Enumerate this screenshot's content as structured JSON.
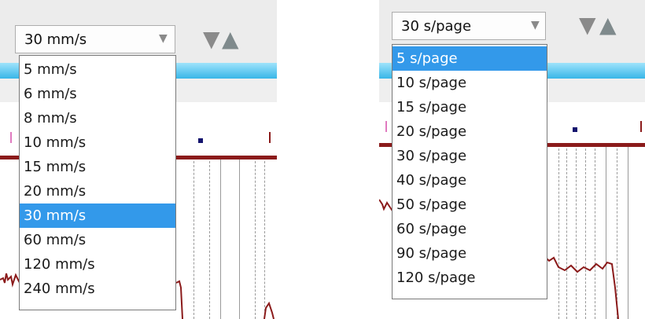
{
  "left_panel": {
    "speed_select": {
      "value": "30 mm/s"
    },
    "nav": {
      "down_icon": "triangle-down-icon",
      "up_icon": "triangle-up-icon"
    },
    "options": [
      "5 mm/s",
      "6 mm/s",
      "8 mm/s",
      "10 mm/s",
      "15 mm/s",
      "20 mm/s",
      "30 mm/s",
      "60 mm/s",
      "120 mm/s",
      "240 mm/s"
    ],
    "selected": "30 mm/s"
  },
  "right_panel": {
    "page_select": {
      "value": "30 s/page"
    },
    "nav": {
      "down_icon": "triangle-down-icon",
      "up_icon": "triangle-up-icon"
    },
    "options": [
      "5 s/page",
      "10 s/page",
      "15 s/page",
      "20 s/page",
      "30 s/page",
      "40 s/page",
      "50 s/page",
      "60 s/page",
      "90 s/page",
      "120 s/page"
    ],
    "selected": "5 s/page"
  },
  "colors": {
    "highlight": "#3399ea",
    "trace": "#8b1b1b",
    "band": "#38b6e8",
    "marker": "#14146e"
  }
}
